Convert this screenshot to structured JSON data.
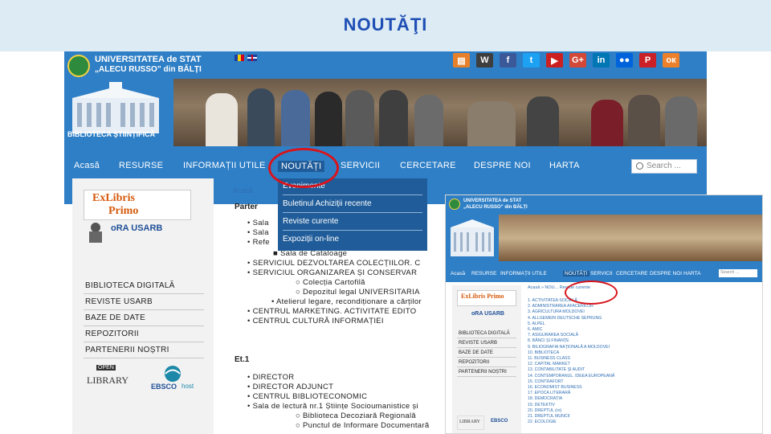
{
  "slide": {
    "title": "NOUTĂŢI"
  },
  "site": {
    "logo": {
      "line1": "UNIVERSITATEA de STAT",
      "line2": "„ALECU RUSSO” din BĂLȚI"
    },
    "building_caption": "BIBLIOTECA ȘTIINȚIFICĂ",
    "social_icons": [
      "blog-icon",
      "wikipedia-icon",
      "facebook-icon",
      "twitter-icon",
      "youtube-icon",
      "google-plus-icon",
      "linkedin-icon",
      "flickr-icon",
      "pinterest-icon",
      "odnoklassniki-icon"
    ],
    "nav": [
      "Acasă",
      "RESURSE",
      "INFORMAȚII UTILE",
      "NOUTĂȚI",
      "SERVICII",
      "CERCETARE",
      "DESPRE NOI",
      "HARTA"
    ],
    "search_placeholder": "Search ...",
    "dropdown": [
      "Evenimente",
      "Buletinul Achiziții recente",
      "Reviste curente",
      "Expoziții on-line"
    ],
    "sidebar_links": [
      "BIBLIOTECA DIGITALĂ",
      "REVISTE USARB",
      "BAZE DE DATE",
      "REPOZITORII",
      "PARTENERII NOȘTRI"
    ],
    "exlibris": {
      "line1": "ExLibris",
      "line2": "Primo"
    },
    "ora_label": "oRA USARB",
    "openlib": {
      "badge": "OPEN",
      "label": "LIBRARY"
    },
    "ebsco": {
      "label": "EBSCO",
      "sub": "host"
    },
    "breadcrumb": "Acasă",
    "content": {
      "parter_heading": "Parter",
      "parter_items": [
        "Sala",
        "Sala",
        "Refe",
        "Sala de Cataloage",
        "SERVICIUL DEZVOLTAREA COLECȚIILOR. C",
        "SERVICIUL ORGANIZAREA ȘI CONSERVAR",
        "Colecția Cartofilă",
        "Depozitul legal UNIVERSITARIA",
        "Atelierul legare, recondiționare a cărților",
        "CENTRUL MARKETING. ACTIVITATE EDITO",
        "CENTRUL CULTURĂ INFORMAȚIEI"
      ],
      "et1_heading": "Et.1",
      "et1_items": [
        "DIRECTOR",
        "DIRECTOR ADJUNCT",
        "CENTRUL BIBLIOTECONOMIC",
        "Sala de lectură nr.1 Științe Socioumanistice și",
        "Biblioteca Decoziară Regională",
        "Punctul de Informare Documentară"
      ]
    }
  },
  "inset": {
    "nav": [
      "Acasă",
      "RESURSE",
      "INFORMAȚII UTILE",
      "NOUTĂȚI",
      "SERVICII",
      "CERCETARE",
      "DESPRE NOI",
      "HARTA"
    ],
    "search_placeholder": "Search ...",
    "breadcrumb": "Acasă » NOU... Reviste curente",
    "sidebar_links": [
      "BIBLIOTECA DIGITALĂ",
      "REVISTE USARB",
      "BAZE DE DATE",
      "REPOZITORII",
      "PARTENERII NOȘTRI"
    ],
    "list": [
      "1. ACTIVITATEA SOCIALĂ",
      "2. ADMINISTRAREA AFACERILOR",
      "3. AGRICULTURA MOLDOVEI",
      "4. ALLGEMEIN DEUTSCHE SEPRUNG",
      "5. ALPEL",
      "6. AMIC",
      "7. ASIGURAREA SOCIALĂ",
      "8. BĂNCI ȘI FINANȚE",
      "9. BILIOGRAFIA NAȚIONALĂ A MOLDOVEI",
      "10. BIBLIOTECA",
      "11. BUSINESS CLASS",
      "12. CAPITAL MARKET",
      "13. CONTABILITATE ȘI AUDIT",
      "14. CONTEMPORANUL. IDEEA EUROPEANĂ",
      "15. CONTRAFORT",
      "16. ECONOMIST BUSINESS",
      "17. EPOCA LITERARĂ",
      "18. DEMOCRAȚIA",
      "19. DETEKTIV",
      "20. DREPTUL (ro)",
      "21. DREPTUL MUNCII",
      "22. ECOLOGIE"
    ]
  },
  "colors": {
    "brand_blue": "#2f7fc6",
    "nav_dark": "#1f5c99",
    "highlight_red": "#d8141c",
    "title_blue": "#1f4fb4"
  }
}
